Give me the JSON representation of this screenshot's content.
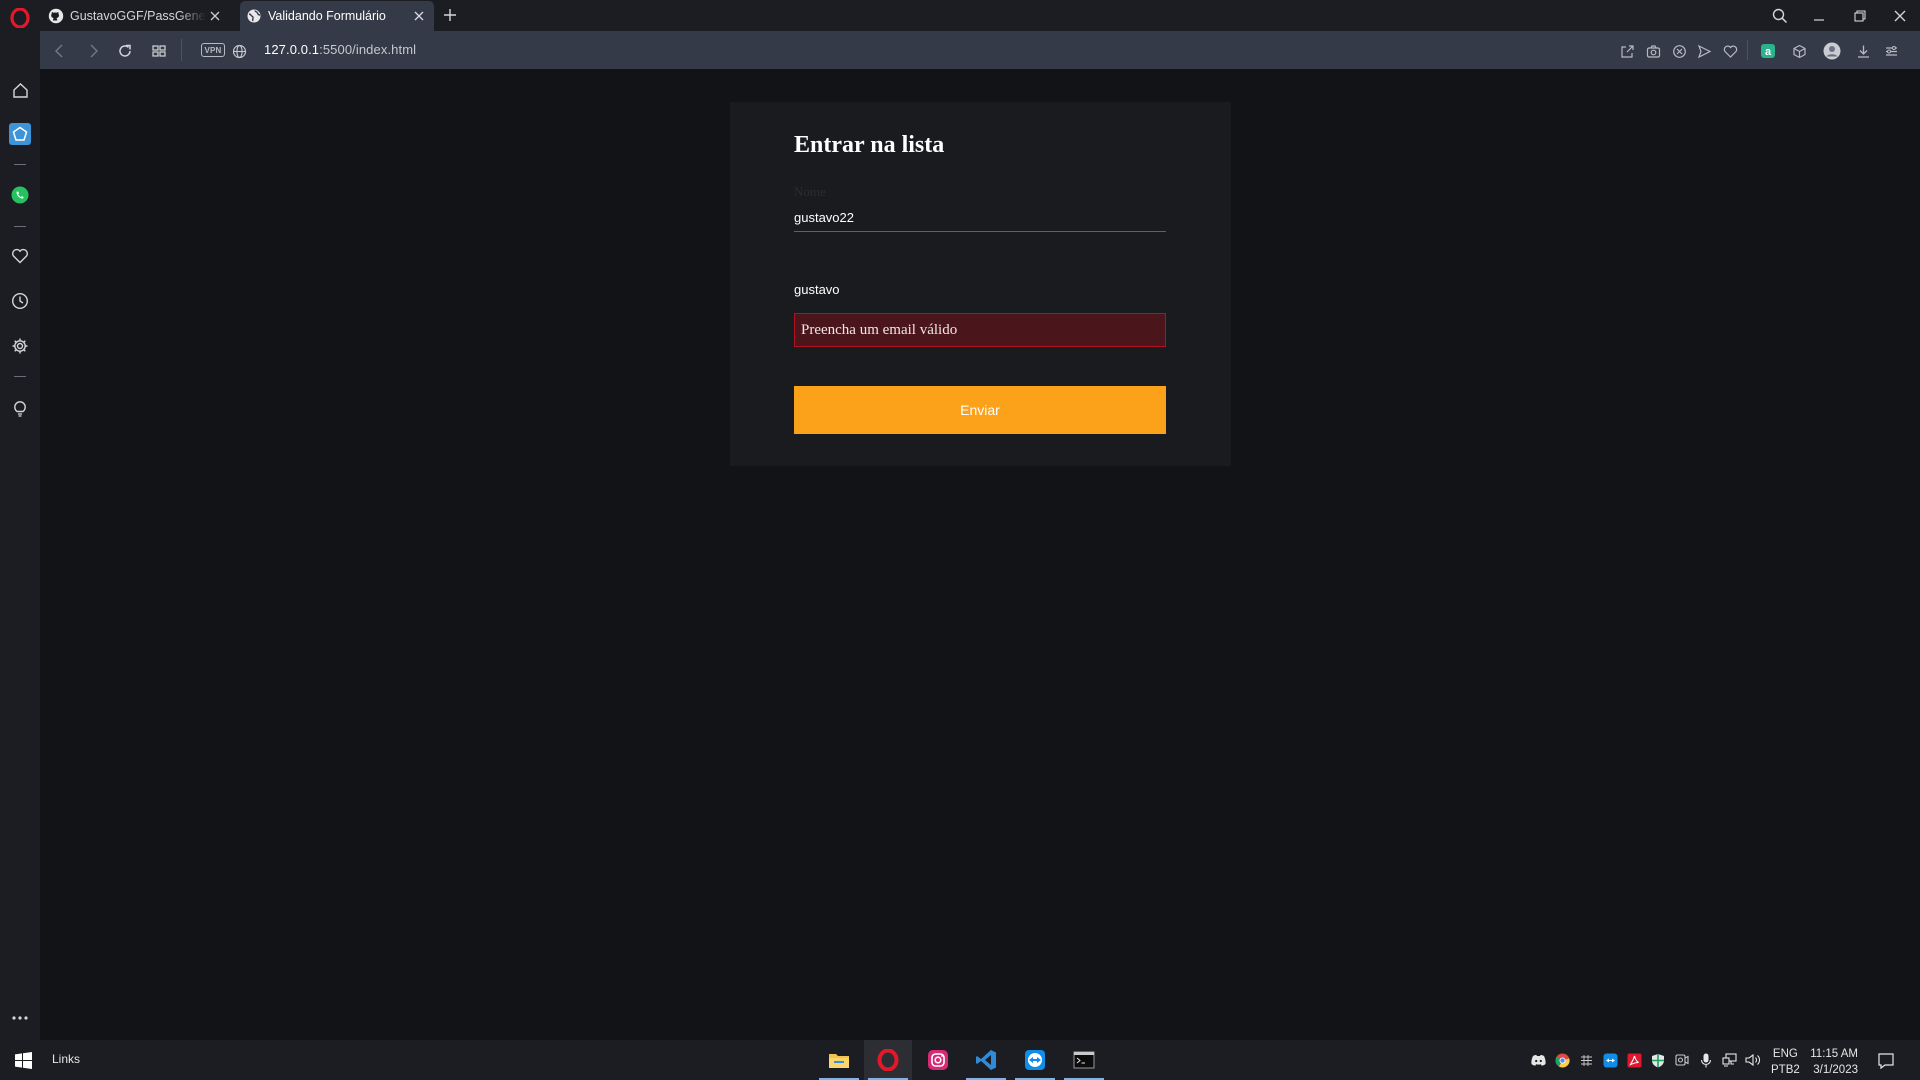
{
  "browser": {
    "tabs": [
      {
        "title": "GustavoGGF/PassGenerator",
        "favicon": "github-icon",
        "active": false
      },
      {
        "title": "Validando Formulário",
        "favicon": "globe-icon",
        "active": true
      }
    ],
    "address": {
      "host": "127.0.0.1",
      "rest": ":5500/index.html"
    },
    "vpn_label": "VPN"
  },
  "form": {
    "title": "Entrar na lista",
    "name_label": "Nome",
    "name_value": "gustavo22",
    "email_value": "gustavo",
    "error_message": "Preencha um email válido",
    "submit_label": "Enviar"
  },
  "taskbar": {
    "links_label": "Links",
    "language": "ENG",
    "keyboard": "PTB2",
    "time": "11:15 AM",
    "date": "3/1/2023"
  },
  "colors": {
    "accent": "#fba11a",
    "error_border": "#b3111f",
    "error_bg": "#4a161b",
    "valid_underline": "#1f8a3a"
  }
}
